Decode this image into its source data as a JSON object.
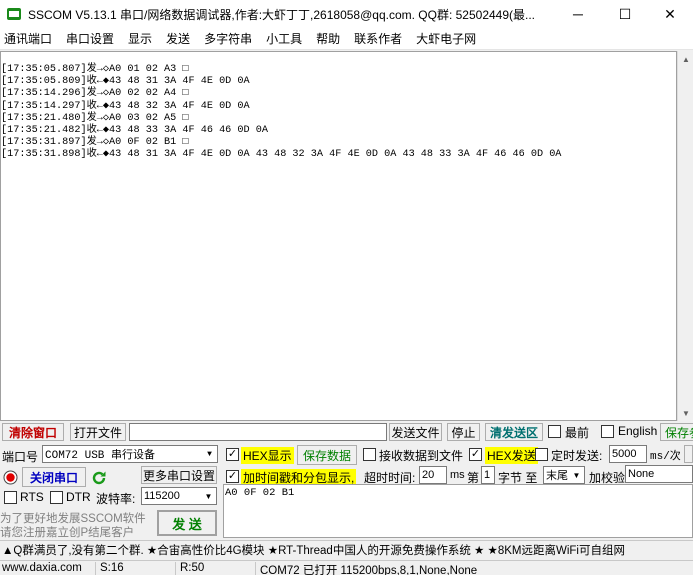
{
  "window": {
    "title": "SSCOM V5.13.1 串口/网络数据调试器,作者:大虾丁丁,2618058@qq.com. QQ群: 52502449(最...",
    "minimize_glyph": "─",
    "maximize_glyph": "☐",
    "close_glyph": "✕"
  },
  "menu": [
    "通讯端口",
    "串口设置",
    "显示",
    "发送",
    "多字符串",
    "小工具",
    "帮助",
    "联系作者",
    "大虾电子网"
  ],
  "receive_log": [
    "[17:35:05.807]发→◇A0 01 02 A3 □",
    "[17:35:05.809]收←◆43 48 31 3A 4F 4E 0D 0A",
    "[17:35:14.296]发→◇A0 02 02 A4 □",
    "[17:35:14.297]收←◆43 48 32 3A 4F 4E 0D 0A",
    "[17:35:21.480]发→◇A0 03 02 A5 □",
    "[17:35:21.482]收←◆43 48 33 3A 4F 46 46 0D 0A",
    "[17:35:31.897]发→◇A0 0F 02 B1 □",
    "[17:35:31.898]收←◆43 48 31 3A 4F 4E 0D 0A 43 48 32 3A 4F 4E 0D 0A 43 48 33 3A 4F 46 46 0D 0A"
  ],
  "toolbar": {
    "clear_window": "清除窗口",
    "open_file": "打开文件",
    "file_path": "",
    "send_file": "发送文件",
    "stop": "停止",
    "clear_send": "清发送区",
    "topmost": "最前",
    "english": "English",
    "save_params": "保存参"
  },
  "port": {
    "port_label": "端口号",
    "port_value": "COM72 USB 串行设备",
    "close_port": "关闭串口",
    "more_settings": "更多串口设置",
    "rts": "RTS",
    "dtr": "DTR",
    "baud_label": "波特率:",
    "baud_value": "115200",
    "promo_line1": "为了更好地发展SSCOM软件",
    "promo_line2": "请您注册嘉立创P结尾客户",
    "send": "发 送"
  },
  "options": {
    "hex_display": "HEX显示",
    "save_data": "保存数据",
    "recv_to_file": "接收数据到文件",
    "hex_send": "HEX发送",
    "timed_send": "定时发送:",
    "interval_value": "5000",
    "interval_unit": "ms/次",
    "add_timestamp": "加时间戳和分包显示,",
    "timeout_label": "超时时间:",
    "timeout_value": "20",
    "timeout_unit": "ms",
    "nth_label": "第",
    "nth_value": "1",
    "byte_label": "字节 至",
    "end_value": "末尾",
    "checksum_label": "加校验",
    "checksum_value": "None"
  },
  "send_text": "A0 0F 02 B1",
  "ad_bar": "▲Q群满员了,没有第二个群. ★合宙高性价比4G模块 ★RT-Thread中国人的开源免费操作系统 ★ ★8KM远距离WiFi可自组网",
  "status_bar": {
    "site": "www.daxia.com",
    "sent": "S:16",
    "recv": "R:50",
    "port_status": "COM72 已打开  115200bps,8,1,None,None"
  },
  "colors": {
    "highlight_yellow": "#ffff00",
    "close_port_blue": "#0000c0",
    "clear_red": "#c00000",
    "clear_send_green": "#007070",
    "save_data_green": "#008000"
  }
}
